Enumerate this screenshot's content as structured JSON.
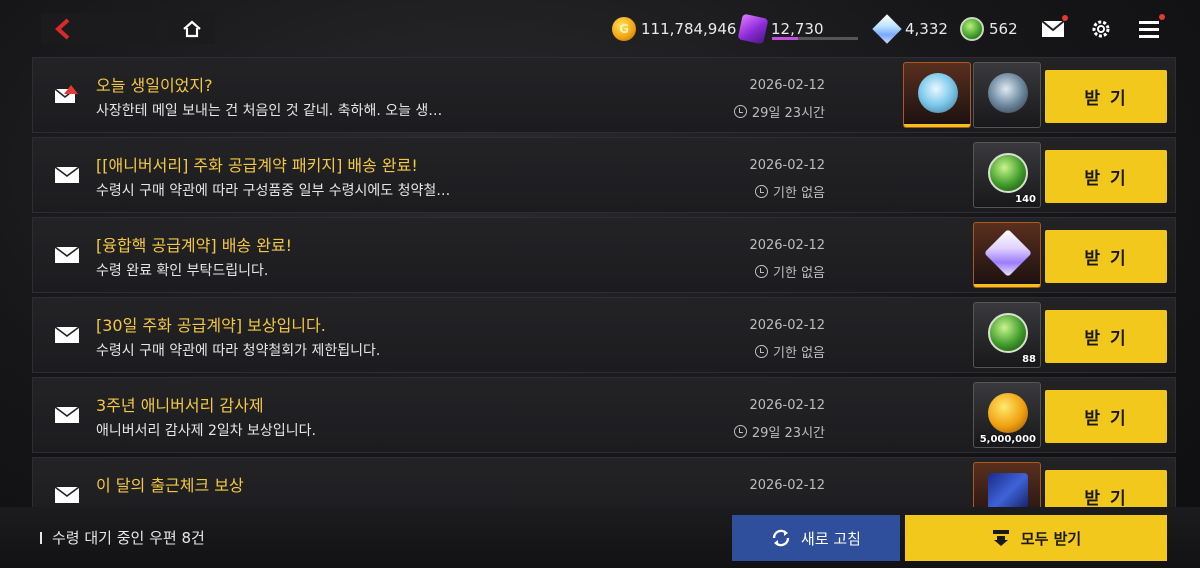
{
  "header": {
    "resources": [
      {
        "icon": "gold-coin-icon",
        "value": "111,784,946"
      },
      {
        "icon": "purple-dice-icon",
        "value": "12,730",
        "bar_fraction": 0.3
      },
      {
        "icon": "crystal-gem-icon",
        "value": "4,332"
      },
      {
        "icon": "green-token-icon",
        "value": "562"
      }
    ]
  },
  "mails": [
    {
      "title": "오늘 생일이었지?",
      "desc": "사장한테 메일 보내는 건 처음인 것 같네. 축하해. 오늘 생…",
      "date": "2026-02-12",
      "expire": "29일 23시간",
      "icon": "birthday-mail-icon",
      "items": [
        {
          "icon": "cake-item-icon",
          "qty": ""
        },
        {
          "icon": "dark-cake-item-icon",
          "qty": ""
        }
      ],
      "claim": "받 기"
    },
    {
      "title": "[[애니버서리] 주화 공급계약 패키지] 배송 완료!",
      "desc": "수령시 구매 약관에 따라 구성품중 일부 수령시에도 청약철…",
      "date": "2026-02-12",
      "expire": "기한 없음",
      "icon": "mail-icon",
      "items": [
        {
          "icon": "green-token-item-icon",
          "qty": "140"
        }
      ],
      "claim": "받 기"
    },
    {
      "title": "[융합핵 공급계약] 배송 완료!",
      "desc": "수령 완료 확인 부탁드립니다.",
      "date": "2026-02-12",
      "expire": "기한 없음",
      "icon": "mail-icon",
      "items": [
        {
          "icon": "crystal-item-icon",
          "qty": ""
        }
      ],
      "claim": "받 기"
    },
    {
      "title": "[30일 주화 공급계약] 보상입니다.",
      "desc": "수령시 구매 약관에 따라 청약철회가 제한됩니다.",
      "date": "2026-02-12",
      "expire": "기한 없음",
      "icon": "mail-icon",
      "items": [
        {
          "icon": "green-token-item-icon",
          "qty": "88"
        }
      ],
      "claim": "받 기"
    },
    {
      "title": "3주년 애니버서리 감사제",
      "desc": "애니버서리 감사제 2일차 보상입니다.",
      "date": "2026-02-12",
      "expire": "29일 23시간",
      "icon": "mail-icon",
      "items": [
        {
          "icon": "gold-coin-item-icon",
          "qty": "5,000,000"
        }
      ],
      "claim": "받 기"
    },
    {
      "title": "이 달의 출근체크 보상",
      "desc": "",
      "date": "2026-02-12",
      "expire": "",
      "icon": "mail-icon",
      "items": [
        {
          "icon": "blue-card-item-icon",
          "qty": ""
        }
      ],
      "claim": "받 기"
    }
  ],
  "footer": {
    "pending": "수령 대기 중인 우편 8건",
    "refresh_label": "새로 고침",
    "claim_all_label": "모두 받기"
  },
  "colors": {
    "accent_yellow": "#f2c81d",
    "title_gold": "#f3c842",
    "refresh_blue": "#2f4f9c",
    "back_red": "#d92a2a"
  }
}
